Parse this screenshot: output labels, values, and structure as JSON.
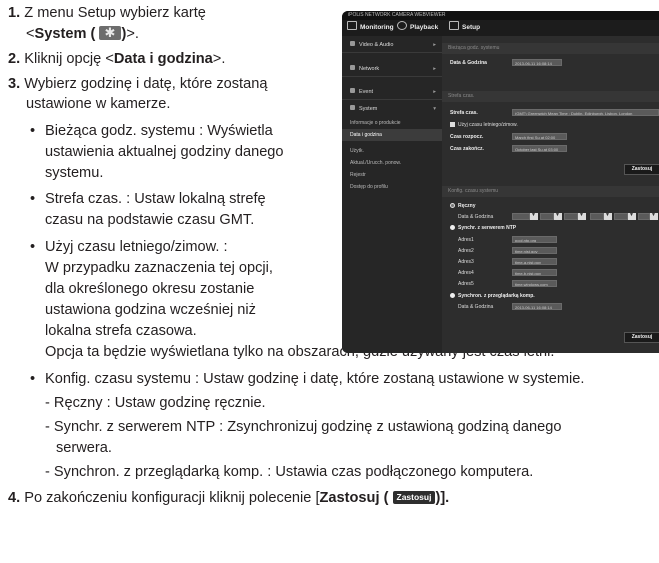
{
  "steps": {
    "s1_num": "1.",
    "s1_pre": "Z menu Setup wybierz kartę",
    "s1_line2_open": "<",
    "s1_bold": "System (",
    "s1_bold_close": ")",
    "s1_line2_close": ">.",
    "s2_num": "2.",
    "s2_pre": "Kliknij opcję <",
    "s2_bold": "Data i godzina",
    "s2_post": ">.",
    "s3_num": "3.",
    "s3_line1": "Wybierz godzinę i datę, które zostaną",
    "s3_line2": "ustawione w kamerze.",
    "b1_l1": "Bieżąca godz. systemu : Wyświetla",
    "b1_l2": "ustawienia aktualnej godziny danego",
    "b1_l3": "systemu.",
    "b2_l1": "Strefa czas. : Ustaw lokalną strefę",
    "b2_l2": "czasu na podstawie czasu GMT.",
    "b3_l1": "Użyj czasu letniego/zimow. :",
    "b3_l2": "W przypadku zaznaczenia tej opcji,",
    "b3_l3": "dla określonego okresu zostanie",
    "b3_l4": "ustawiona godzina wcześniej niż",
    "b3_l5": "lokalna strefa czasowa.",
    "b3_l6": "Opcja ta będzie wyświetlana tylko na obszarach, gdzie używany jest czas letni.",
    "b4": "Konfig. czasu systemu : Ustaw godzinę i datę, które zostaną ustawione w systemie.",
    "d1": "- Ręczny : Ustaw godzinę ręcznie.",
    "d2_l1": "- Synchr. z serwerem NTP : Zsynchronizuj godzinę z ustawioną godziną danego",
    "d2_l2": "serwera.",
    "d3": "- Synchron. z przeglądarką komp. : Ustawia czas podłączonego komputera.",
    "s4_num": "4.",
    "s4_pre": "Po zakończeniu konfiguracji kliknij polecenie [",
    "s4_bold": "Zastosuj (",
    "s4_btn": "Zastosuj",
    "s4_post": ")]."
  },
  "screenshot": {
    "topbar": "iPOLiS NETWORK CAMERA WEBVIEWER",
    "tab_monitoring": "Monitoring",
    "tab_playback": "Playback",
    "tab_setup": "Setup",
    "side_items": [
      "Video & Audio",
      "Network",
      "Event",
      "System"
    ],
    "side_sub": [
      "Informacje o produkcie",
      "Data i godzina",
      "Użytk.",
      "Aktual./Urucch. ponow.",
      "Rejestr",
      "Dostęp do profilu"
    ],
    "sec1": "Bieżąca godz. systemu",
    "data_godzina": "Data & Godzina",
    "current_value": "2013-06-11 16:08:14",
    "sec2": "Strefa czas.",
    "tz_label": "Strefa czas.",
    "tz_value": "(GMT) Greenwich Mean Time : Dublin, Edinburgh, Lisbon, London",
    "dst_check": "Użyj czasu letniego/zimow.",
    "dst_start_label": "Czas rozpocz.",
    "dst_start_val": "March first Su at 02:00",
    "dst_end_label": "Czas zakończ.",
    "dst_end_val": "October last Su at 03:00",
    "apply": "Zastosuj",
    "sec3": "Konfig. czasu systemu",
    "manual": "Ręczny",
    "manual_date": "Data & Godzina",
    "ntp": "Synchr. z serwerem NTP",
    "addr_labels": [
      "Adres1",
      "Adres2",
      "Adres3",
      "Adres4",
      "Adres5"
    ],
    "addr_values": [
      "pool.ntp.org",
      "time.nist.gov",
      "time-a.nist.gov",
      "time-b.nist.gov",
      "time.windows.com"
    ],
    "pc": "Synchron. z przeglądarką komp.",
    "pc_date": "Data & Godzina",
    "pc_value": "2013-06-11 16:08:14",
    "apply2": "Zastosuj"
  }
}
